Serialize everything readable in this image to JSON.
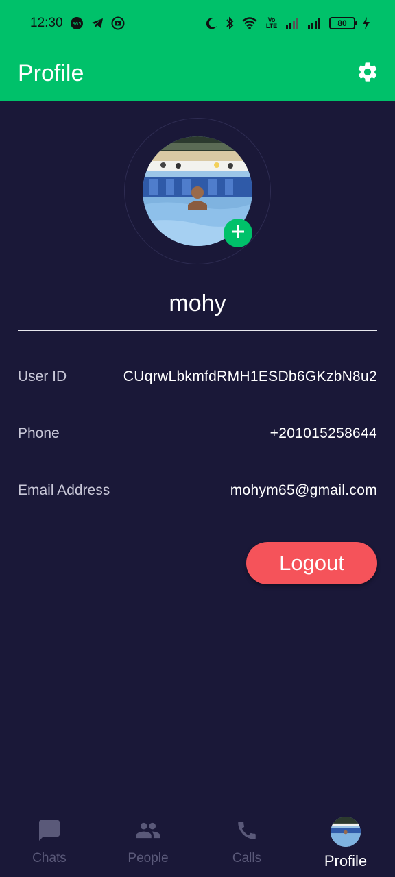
{
  "status_bar": {
    "time": "12:30",
    "left_icons": [
      "notification-app-icon",
      "telegram-icon",
      "youtube-icon"
    ],
    "right_icons": [
      "moon-icon",
      "bluetooth-icon",
      "wifi-icon",
      "volte-icon",
      "signal-icon",
      "signal-icon",
      "battery-icon",
      "charging-icon"
    ],
    "volte_label": "Vo LTE",
    "battery": "80"
  },
  "app_bar": {
    "title": "Profile",
    "settings_icon": "gear-icon"
  },
  "profile": {
    "name": "mohy",
    "avatar_desc": "profile-photo",
    "add_photo_icon": "plus-icon"
  },
  "info": [
    {
      "label": "User ID",
      "value": "CUqrwLbkmfdRMH1ESDb6GKzbN8u2"
    },
    {
      "label": "Phone",
      "value": "+201015258644"
    },
    {
      "label": "Email Address",
      "value": "mohym65@gmail.com"
    }
  ],
  "actions": {
    "logout_label": "Logout"
  },
  "bottom_nav": [
    {
      "label": "Chats",
      "icon": "chat-icon",
      "active": false
    },
    {
      "label": "People",
      "icon": "people-icon",
      "active": false
    },
    {
      "label": "Calls",
      "icon": "phone-icon",
      "active": false
    },
    {
      "label": "Profile",
      "icon": "avatar",
      "active": true
    }
  ],
  "colors": {
    "accent": "#00c16a",
    "background": "#1a1838",
    "logout": "#f5535a",
    "inactive_nav": "#5a5979"
  }
}
